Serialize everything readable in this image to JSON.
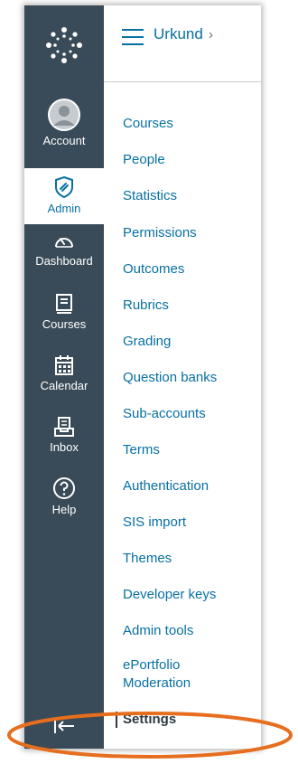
{
  "nav": {
    "account": "Account",
    "admin": "Admin",
    "dashboard": "Dashboard",
    "courses": "Courses",
    "calendar": "Calendar",
    "inbox": "Inbox",
    "help": "Help"
  },
  "header": {
    "breadcrumb": "Urkund",
    "separator": "›"
  },
  "menu": [
    "Courses",
    "People",
    "Statistics",
    "Permissions",
    "Outcomes",
    "Rubrics",
    "Grading",
    "Question banks",
    "Sub-accounts",
    "Terms",
    "Authentication",
    "SIS import",
    "Themes",
    "Developer keys",
    "Admin tools",
    "ePortfolio",
    "Moderation",
    "Settings"
  ],
  "colors": {
    "rail": "#394b58",
    "link": "#0770a3",
    "highlight": "#e66e1e"
  }
}
